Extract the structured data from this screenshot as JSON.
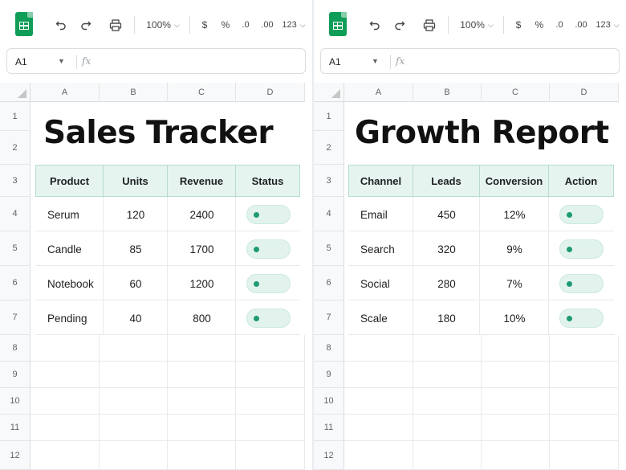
{
  "toolbar": {
    "zoom": "100%",
    "currency": "$",
    "percent": "%",
    "decrease_decimal": ".0",
    "increase_decimal": ".00",
    "more_formats": "123"
  },
  "name_box": {
    "ref": "A1",
    "fx": "fx"
  },
  "columns": [
    "A",
    "B",
    "C",
    "D"
  ],
  "rows": [
    "1",
    "2",
    "3",
    "4",
    "5",
    "6",
    "7",
    "8",
    "9",
    "10",
    "11",
    "12"
  ],
  "left": {
    "title": "Sales Tracker",
    "headers": [
      "Product",
      "Units",
      "Revenue",
      "Status"
    ],
    "data": [
      [
        "Serum",
        "120",
        "2400"
      ],
      [
        "Candle",
        "85",
        "1700"
      ],
      [
        "Notebook",
        "60",
        "1200"
      ],
      [
        "Pending",
        "40",
        "800"
      ]
    ],
    "toggles_on": [
      true,
      true,
      true,
      true
    ]
  },
  "right": {
    "title": "Growth Report",
    "headers": [
      "Channel",
      "Leads",
      "Conversion",
      "Action"
    ],
    "data": [
      [
        "Email",
        "450",
        "12%"
      ],
      [
        "Search",
        "320",
        "9%"
      ],
      [
        "Social",
        "280",
        "7%"
      ],
      [
        "Scale",
        "180",
        "10%"
      ]
    ],
    "toggles_on": [
      true,
      true,
      true,
      true
    ]
  },
  "colors": {
    "brand": "#0f9d58",
    "accent": "#1e9a74",
    "header_fill": "#e6f4f0"
  }
}
